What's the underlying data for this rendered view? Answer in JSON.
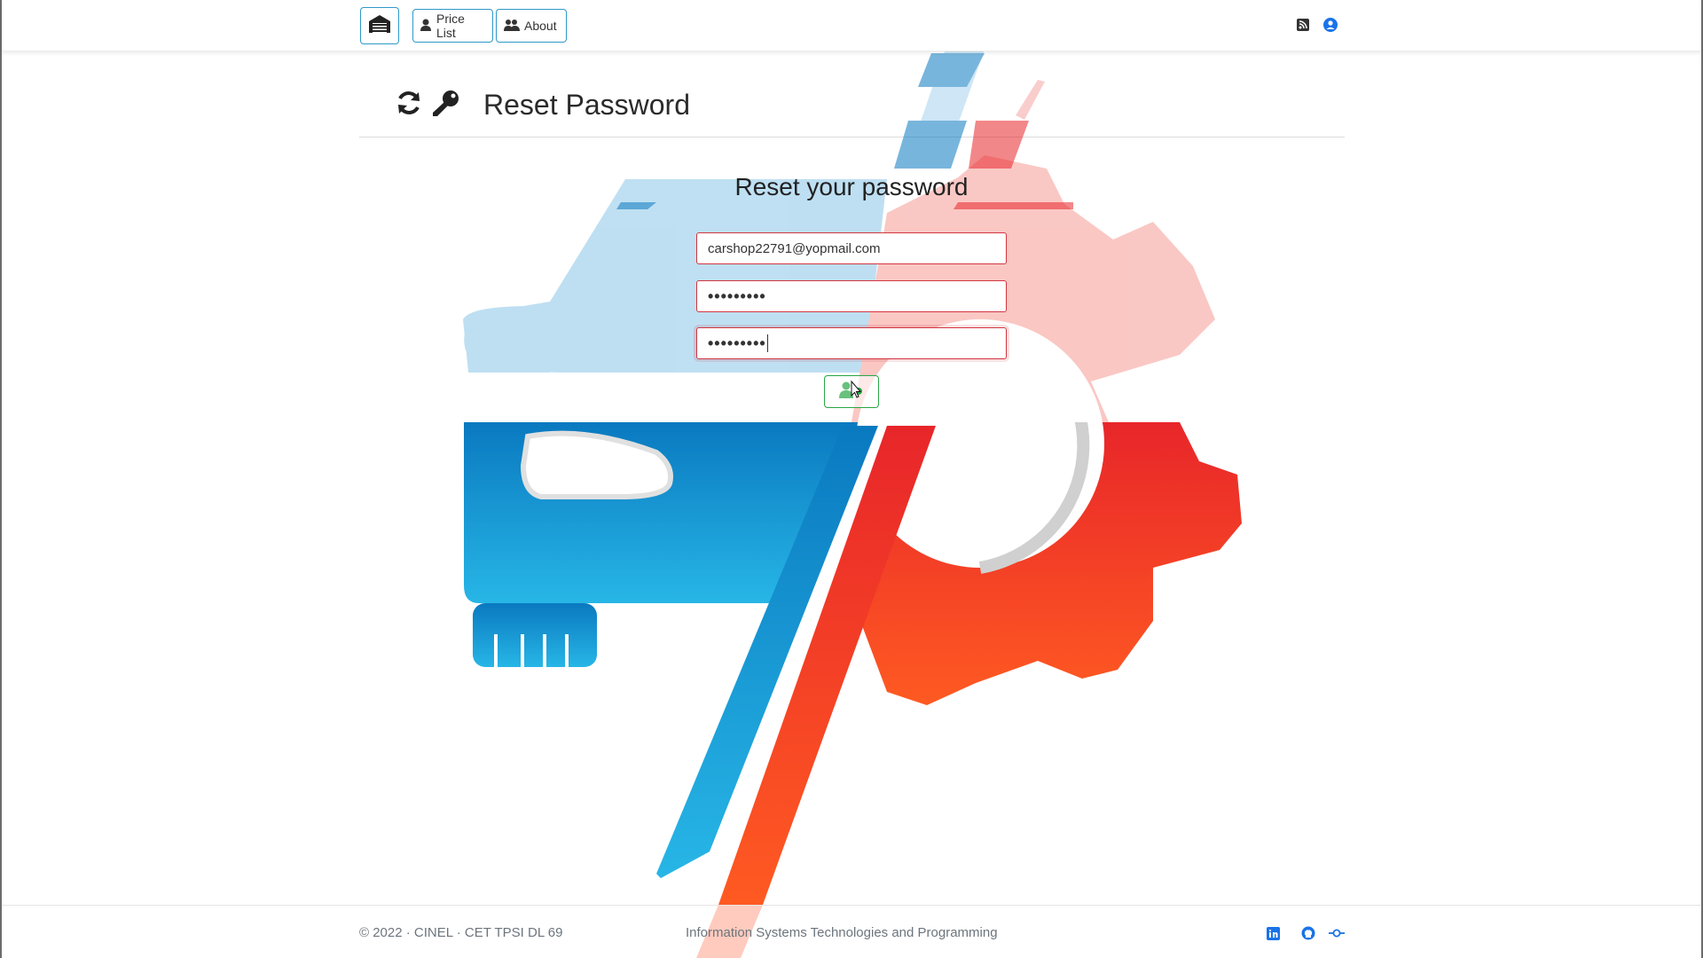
{
  "navbar": {
    "brand_icon": "garage-icon",
    "price_list_label": "Price List",
    "price_list_icon": "user-tag-icon",
    "about_label": "About",
    "about_icon": "users-icon",
    "rss_icon": "rss-icon",
    "user_icon": "user-circle-icon"
  },
  "header": {
    "title": "Reset Password",
    "icons": [
      "sync-icon",
      "key-icon"
    ]
  },
  "form": {
    "title": "Reset your password",
    "email_value": "carshop22791@yopmail.com",
    "password_value": "•••••••••",
    "confirm_password_value": "•••••••••",
    "submit_icon": "user-check-icon"
  },
  "footer": {
    "copyright": "© 2022 · CINEL · CET TPSI DL 69",
    "tagline": "Information Systems Technologies and Programming",
    "icons": [
      "linkedin-icon",
      "github-icon",
      "commit-icon"
    ]
  },
  "colors": {
    "accent_blue": "#2f98c9",
    "logo_blue": "#1a8fd1",
    "logo_red": "#ee3a2a",
    "error_red": "#d2353f",
    "success_green": "#28a745",
    "icon_blue": "#1a73e8"
  }
}
